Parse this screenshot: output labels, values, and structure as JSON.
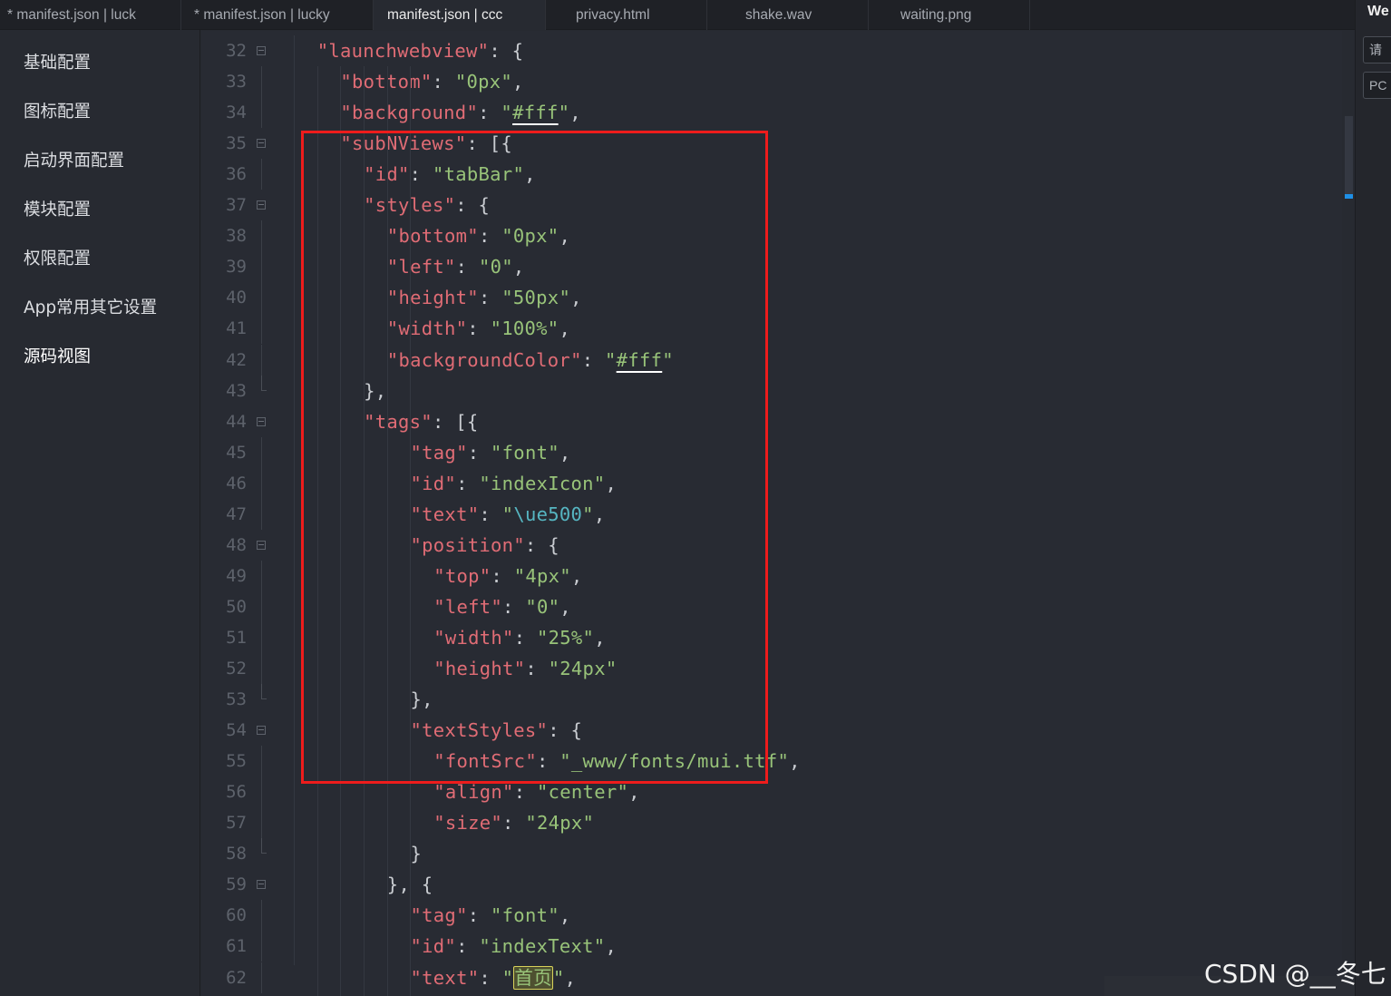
{
  "tabs": [
    {
      "label": "* manifest.json | luck",
      "active": false
    },
    {
      "label": "* manifest.json | lucky",
      "active": false
    },
    {
      "label": "manifest.json | ccc",
      "active": true
    },
    {
      "label": "privacy.html",
      "active": false
    },
    {
      "label": "shake.wav",
      "active": false
    },
    {
      "label": "waiting.png",
      "active": false
    }
  ],
  "sidebar": {
    "items": [
      {
        "label": "基础配置"
      },
      {
        "label": "图标配置"
      },
      {
        "label": "启动界面配置"
      },
      {
        "label": "模块配置"
      },
      {
        "label": "权限配置"
      },
      {
        "label": "App常用其它设置"
      },
      {
        "label": "源码视图",
        "active": true
      }
    ]
  },
  "right_panel": {
    "title": "We",
    "input1": "请",
    "input2": "PC"
  },
  "editor": {
    "lines": [
      {
        "n": "32",
        "fold": "open",
        "indent": 1,
        "tokens": [
          [
            "k",
            "\"launchwebview\""
          ],
          [
            "p",
            ": {"
          ]
        ]
      },
      {
        "n": "33",
        "indent": 2,
        "tokens": [
          [
            "k",
            "\"bottom\""
          ],
          [
            "p",
            ": "
          ],
          [
            "s",
            "\"0px\""
          ],
          [
            "p",
            ","
          ]
        ]
      },
      {
        "n": "34",
        "indent": 2,
        "tokens": [
          [
            "k",
            "\"background\""
          ],
          [
            "p",
            ": "
          ],
          [
            "s",
            "\""
          ],
          [
            "su",
            "#fff"
          ],
          [
            "s",
            "\""
          ],
          [
            "p",
            ","
          ]
        ]
      },
      {
        "n": "35",
        "fold": "open",
        "indent": 2,
        "tokens": [
          [
            "k",
            "\"subNViews\""
          ],
          [
            "p",
            ": [{"
          ]
        ]
      },
      {
        "n": "36",
        "indent": 3,
        "tokens": [
          [
            "k",
            "\"id\""
          ],
          [
            "p",
            ": "
          ],
          [
            "s",
            "\"tabBar\""
          ],
          [
            "p",
            ","
          ]
        ]
      },
      {
        "n": "37",
        "fold": "open",
        "indent": 3,
        "tokens": [
          [
            "k",
            "\"styles\""
          ],
          [
            "p",
            ": {"
          ]
        ]
      },
      {
        "n": "38",
        "indent": 4,
        "tokens": [
          [
            "k",
            "\"bottom\""
          ],
          [
            "p",
            ": "
          ],
          [
            "s",
            "\"0px\""
          ],
          [
            "p",
            ","
          ]
        ]
      },
      {
        "n": "39",
        "indent": 4,
        "tokens": [
          [
            "k",
            "\"left\""
          ],
          [
            "p",
            ": "
          ],
          [
            "s",
            "\"0\""
          ],
          [
            "p",
            ","
          ]
        ]
      },
      {
        "n": "40",
        "indent": 4,
        "tokens": [
          [
            "k",
            "\"height\""
          ],
          [
            "p",
            ": "
          ],
          [
            "s",
            "\"50px\""
          ],
          [
            "p",
            ","
          ]
        ]
      },
      {
        "n": "41",
        "indent": 4,
        "tokens": [
          [
            "k",
            "\"width\""
          ],
          [
            "p",
            ": "
          ],
          [
            "s",
            "\"100%\""
          ],
          [
            "p",
            ","
          ]
        ]
      },
      {
        "n": "42",
        "indent": 4,
        "tokens": [
          [
            "k",
            "\"backgroundColor\""
          ],
          [
            "p",
            ": "
          ],
          [
            "s",
            "\""
          ],
          [
            "su",
            "#fff"
          ],
          [
            "s",
            "\""
          ]
        ]
      },
      {
        "n": "43",
        "fold": "end",
        "indent": 3,
        "tokens": [
          [
            "p",
            "},"
          ]
        ]
      },
      {
        "n": "44",
        "fold": "open",
        "indent": 3,
        "tokens": [
          [
            "k",
            "\"tags\""
          ],
          [
            "p",
            ": [{"
          ]
        ]
      },
      {
        "n": "45",
        "indent": 5,
        "tokens": [
          [
            "k",
            "\"tag\""
          ],
          [
            "p",
            ": "
          ],
          [
            "s",
            "\"font\""
          ],
          [
            "p",
            ","
          ]
        ]
      },
      {
        "n": "46",
        "indent": 5,
        "tokens": [
          [
            "k",
            "\"id\""
          ],
          [
            "p",
            ": "
          ],
          [
            "s",
            "\"indexIcon\""
          ],
          [
            "p",
            ","
          ]
        ]
      },
      {
        "n": "47",
        "indent": 5,
        "tokens": [
          [
            "k",
            "\"text\""
          ],
          [
            "p",
            ": "
          ],
          [
            "s",
            "\""
          ],
          [
            "e",
            "\\ue500"
          ],
          [
            "s",
            "\""
          ],
          [
            "p",
            ","
          ]
        ]
      },
      {
        "n": "48",
        "fold": "open",
        "indent": 5,
        "tokens": [
          [
            "k",
            "\"position\""
          ],
          [
            "p",
            ": {"
          ]
        ]
      },
      {
        "n": "49",
        "indent": 6,
        "tokens": [
          [
            "k",
            "\"top\""
          ],
          [
            "p",
            ": "
          ],
          [
            "s",
            "\"4px\""
          ],
          [
            "p",
            ","
          ]
        ]
      },
      {
        "n": "50",
        "indent": 6,
        "tokens": [
          [
            "k",
            "\"left\""
          ],
          [
            "p",
            ": "
          ],
          [
            "s",
            "\"0\""
          ],
          [
            "p",
            ","
          ]
        ]
      },
      {
        "n": "51",
        "indent": 6,
        "tokens": [
          [
            "k",
            "\"width\""
          ],
          [
            "p",
            ": "
          ],
          [
            "s",
            "\"25%\""
          ],
          [
            "p",
            ","
          ]
        ]
      },
      {
        "n": "52",
        "indent": 6,
        "tokens": [
          [
            "k",
            "\"height\""
          ],
          [
            "p",
            ": "
          ],
          [
            "s",
            "\"24px\""
          ]
        ]
      },
      {
        "n": "53",
        "fold": "end",
        "indent": 5,
        "tokens": [
          [
            "p",
            "},"
          ]
        ]
      },
      {
        "n": "54",
        "fold": "open",
        "indent": 5,
        "tokens": [
          [
            "k",
            "\"textStyles\""
          ],
          [
            "p",
            ": {"
          ]
        ]
      },
      {
        "n": "55",
        "indent": 6,
        "tokens": [
          [
            "k",
            "\"fontSrc\""
          ],
          [
            "p",
            ": "
          ],
          [
            "s",
            "\"_www/fonts/mui.ttf\""
          ],
          [
            "p",
            ","
          ]
        ]
      },
      {
        "n": "56",
        "indent": 6,
        "tokens": [
          [
            "k",
            "\"align\""
          ],
          [
            "p",
            ": "
          ],
          [
            "s",
            "\"center\""
          ],
          [
            "p",
            ","
          ]
        ]
      },
      {
        "n": "57",
        "indent": 6,
        "tokens": [
          [
            "k",
            "\"size\""
          ],
          [
            "p",
            ": "
          ],
          [
            "s",
            "\"24px\""
          ]
        ]
      },
      {
        "n": "58",
        "fold": "end",
        "indent": 5,
        "tokens": [
          [
            "p",
            "}"
          ]
        ]
      },
      {
        "n": "59",
        "fold": "open",
        "indent": 4,
        "tokens": [
          [
            "p",
            "}, {"
          ]
        ]
      },
      {
        "n": "60",
        "indent": 5,
        "tokens": [
          [
            "k",
            "\"tag\""
          ],
          [
            "p",
            ": "
          ],
          [
            "s",
            "\"font\""
          ],
          [
            "p",
            ","
          ]
        ]
      },
      {
        "n": "61",
        "indent": 5,
        "tokens": [
          [
            "k",
            "\"id\""
          ],
          [
            "p",
            ": "
          ],
          [
            "s",
            "\"indexText\""
          ],
          [
            "p",
            ","
          ]
        ]
      },
      {
        "n": "62",
        "indent": 5,
        "tokens": [
          [
            "k",
            "\"text\""
          ],
          [
            "p",
            ": "
          ],
          [
            "s",
            "\""
          ],
          [
            "sh",
            "首页"
          ],
          [
            "s",
            "\""
          ],
          [
            "p",
            ","
          ]
        ]
      }
    ]
  },
  "watermark": "CSDN @__冬七"
}
